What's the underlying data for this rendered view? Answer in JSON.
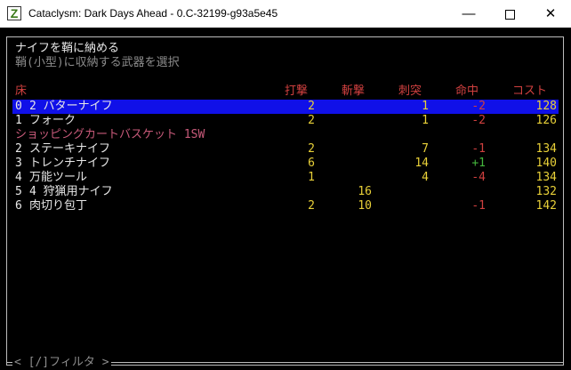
{
  "window": {
    "title": "Cataclysm: Dark Days Ahead - 0.C-32199-g93a5e45",
    "icon_letter": "Z",
    "minimize_icon": "minimize-icon",
    "maximize_icon": "maximize-icon",
    "close_icon": "close-icon",
    "close_glyph": "✕",
    "min_glyph": "—"
  },
  "menu": {
    "title": "ナイフを鞘に納める",
    "subtitle": "鞘(小型)に収納する武器を選択",
    "location_header": "床",
    "columns": [
      "打撃",
      "斬撃",
      "刺突",
      "命中",
      "コスト"
    ],
    "items": [
      {
        "key": "0",
        "name": "2 バターナイフ",
        "bash": "2",
        "cut": "",
        "pierce": "1",
        "hit": "-2",
        "cost": "128",
        "selected": true
      },
      {
        "key": "1",
        "name": "フォーク",
        "bash": "2",
        "cut": "",
        "pierce": "1",
        "hit": "-2",
        "cost": "126",
        "selected": false
      }
    ],
    "container_header": "ショッピングカートバスケット 1SW",
    "container_items": [
      {
        "key": "2",
        "name": "ステーキナイフ",
        "bash": "2",
        "cut": "",
        "pierce": "7",
        "hit": "-1",
        "cost": "134"
      },
      {
        "key": "3",
        "name": "トレンチナイフ",
        "bash": "6",
        "cut": "",
        "pierce": "14",
        "hit": "+1",
        "cost": "140"
      },
      {
        "key": "4",
        "name": "万能ツール",
        "bash": "1",
        "cut": "",
        "pierce": "4",
        "hit": "-4",
        "cost": "134"
      },
      {
        "key": "5",
        "name": "4 狩猟用ナイフ",
        "bash": "",
        "cut": "16",
        "pierce": "",
        "hit": "",
        "cost": "132"
      },
      {
        "key": "6",
        "name": "肉切り包丁",
        "bash": "2",
        "cut": "10",
        "pierce": "",
        "hit": "-1",
        "cost": "142"
      }
    ],
    "footer": "< [/]フィルタ >"
  },
  "colors": {
    "selection": "#1010e8",
    "header": "#d0403f",
    "value": "#e8d038",
    "positive": "#44b63c",
    "container": "#c85a7a"
  }
}
